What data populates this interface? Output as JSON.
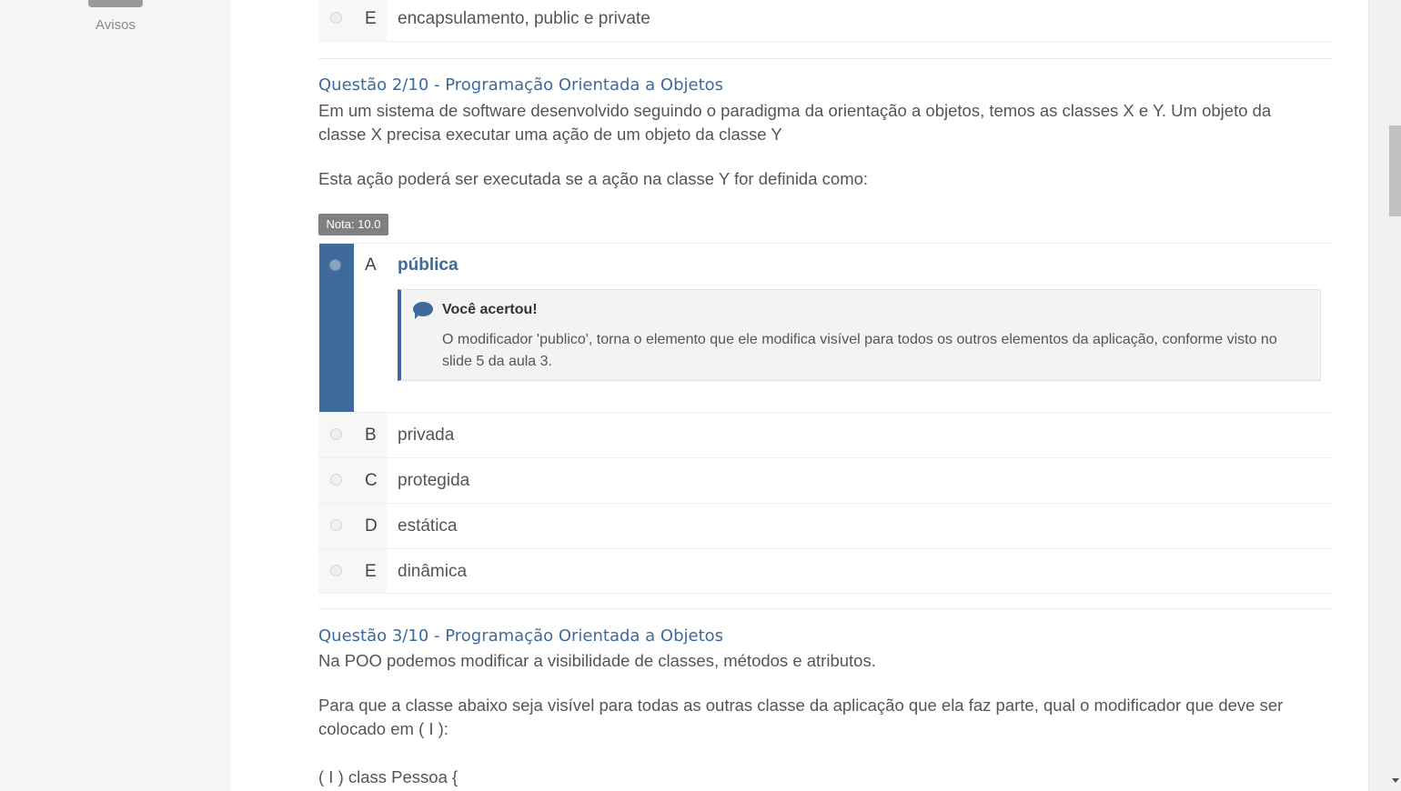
{
  "sidebar": {
    "avisos_label": "Avisos"
  },
  "prev_question": {
    "option_e": {
      "letter": "E",
      "text": "encapsulamento, public e private"
    }
  },
  "question2": {
    "title": "Questão 2/10 - Programação Orientada a Objetos",
    "text1": "Em um sistema de software desenvolvido seguindo o paradigma da orientação a objetos, temos as classes X e Y. Um objeto da classe X precisa executar uma ação de um objeto da classe Y",
    "text2": "Esta ação poderá ser executada se a ação na classe Y for definida como:",
    "grade": "Nota: 10.0",
    "options": [
      {
        "letter": "A",
        "text": "pública"
      },
      {
        "letter": "B",
        "text": "privada"
      },
      {
        "letter": "C",
        "text": "protegida"
      },
      {
        "letter": "D",
        "text": "estática"
      },
      {
        "letter": "E",
        "text": "dinâmica"
      }
    ],
    "feedback": {
      "title": "Você acertou!",
      "text": "O modificador 'publico', torna o elemento que ele modifica visível para todos os outros elementos da aplicação, conforme visto no slide 5 da aula 3."
    }
  },
  "question3": {
    "title": "Questão 3/10 - Programação Orientada a Objetos",
    "text1": "Na POO podemos modificar a visibilidade de classes, métodos e atributos.",
    "text2": "Para que a classe abaixo seja visível para todas as outras classe da aplicação que ela faz parte, qual o modificador que deve ser colocado em ( I ):",
    "code_line": "( I ) class Pessoa {"
  }
}
